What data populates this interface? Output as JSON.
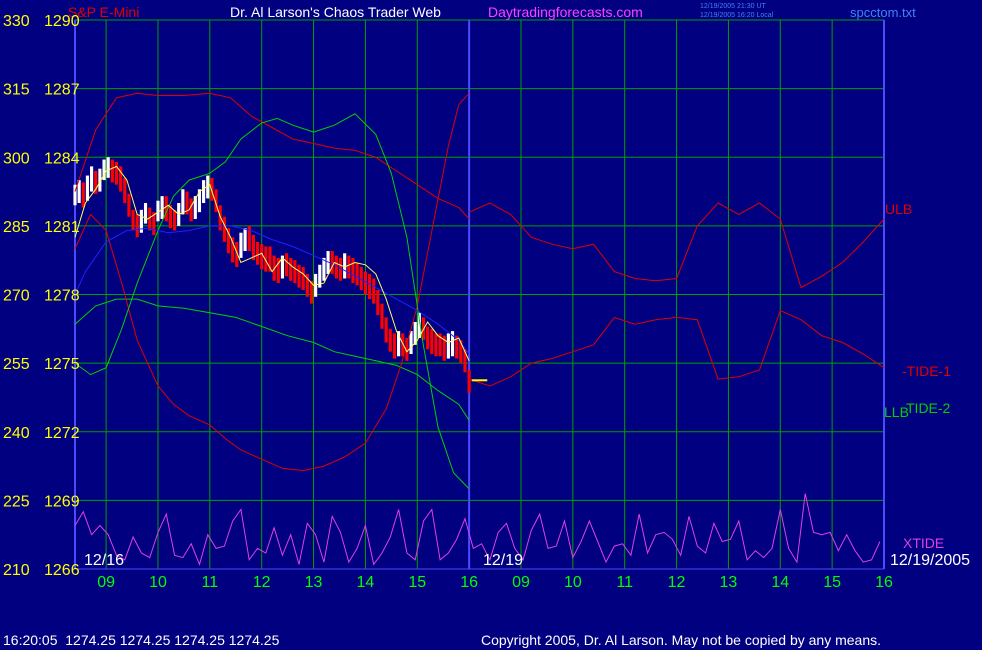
{
  "header": {
    "instrument": "S&P E-Mini",
    "title": "Dr. Al Larson's Chaos Trader Web",
    "site": "Daytradingforecasts.com",
    "timestamp_ut": "12/19/2005 21:30 UT",
    "timestamp_local": "12/19/2005 16:20 Local",
    "file": "spcctom.txt"
  },
  "footer": {
    "quote": "16:20:05  1274.25 1274.25 1274.25 1274.25",
    "copyright": "Copyright 2005, Dr. Al Larson. May not be copied by any means."
  },
  "colors": {
    "background": "#000080",
    "grid": "#00a000",
    "axis": "#4a4aff",
    "price_labels": "#ffff00",
    "time_labels": "#00ff00",
    "date_labels": "#ffffff",
    "ulb": "#e00000",
    "llb": "#00d000",
    "tide1": "#e00000",
    "tide2": "#00d000",
    "xtide": "#e040e0",
    "sma": "#2020ff",
    "price_line": "#ffff60",
    "up_bar": "#ffffff",
    "down_bar": "#ff0000",
    "header_title": "#ffffff",
    "header_site": "#ff40ff",
    "header_file": "#4080ff",
    "footer_text": "#ffffff"
  },
  "chart_data": {
    "type": "line",
    "left_axis_labels": [
      "330",
      "315",
      "300",
      "285",
      "270",
      "255",
      "240",
      "225",
      "210"
    ],
    "price_axis_labels": [
      "1290",
      "1287",
      "1284",
      "1281",
      "1278",
      "1275",
      "1272",
      "1269",
      "1266"
    ],
    "price_range": [
      1266,
      1290
    ],
    "time_labels": [
      "09",
      "10",
      "11",
      "12",
      "13",
      "14",
      "15",
      "16",
      "09",
      "10",
      "11",
      "12",
      "13",
      "14",
      "15",
      "16"
    ],
    "date_labels": [
      "12/16",
      "12/19",
      "12/19/2005"
    ],
    "series_labels": {
      "ulb": "ULB",
      "llb": "LLB",
      "tide1": "-TIDE-1",
      "tide2": "TIDE-2",
      "xtide": "XTIDE"
    },
    "last_price_marker": 1274.25,
    "series": [
      {
        "key": "ulb",
        "x": [
          8.4,
          8.8,
          9.2,
          9.6,
          10,
          10.5,
          11,
          11.4,
          11.8,
          12.2,
          12.6,
          13,
          13.4,
          13.8,
          14.2,
          14.6,
          15,
          15.4,
          15.8,
          16
        ],
        "y": [
          1282.5,
          1285.2,
          1286.6,
          1286.8,
          1286.7,
          1286.7,
          1286.8,
          1286.6,
          1285.8,
          1285.3,
          1284.8,
          1284.6,
          1284.4,
          1284.3,
          1284.0,
          1283.4,
          1282.8,
          1282.2,
          1281.8,
          1281.3
        ]
      },
      {
        "key": "llb",
        "x": [
          8.4,
          8.8,
          9.2,
          9.6,
          10,
          10.5,
          11,
          11.5,
          12,
          12.5,
          13,
          13.4,
          13.8,
          14.2,
          14.6,
          15,
          15.4,
          15.8,
          16
        ],
        "y": [
          1276.7,
          1277.5,
          1277.8,
          1277.8,
          1277.5,
          1277.4,
          1277.2,
          1277.0,
          1276.6,
          1276.2,
          1275.9,
          1275.5,
          1275.3,
          1275.1,
          1274.9,
          1274.5,
          1273.8,
          1273.2,
          1272.5
        ]
      },
      {
        "key": "tide1",
        "x": [
          8.4,
          8.7,
          9.0,
          9.3,
          9.6,
          10,
          10.3,
          10.6,
          11,
          11.3,
          11.6,
          12,
          12.4,
          12.8,
          13.2,
          13.6,
          14,
          14.4,
          14.7,
          15,
          15.3,
          15.6,
          15.8,
          16
        ],
        "y": [
          1280,
          1281.5,
          1280.8,
          1278.5,
          1276,
          1274,
          1273.2,
          1272.7,
          1272.3,
          1271.7,
          1271.2,
          1270.8,
          1270.4,
          1270.3,
          1270.5,
          1270.9,
          1271.5,
          1273,
          1275,
          1277.5,
          1281,
          1284.5,
          1286.3,
          1286.8
        ]
      },
      {
        "key": "tide2",
        "x": [
          8.4,
          8.7,
          9.0,
          9.3,
          9.6,
          10,
          10.3,
          10.6,
          11,
          11.3,
          11.6,
          12,
          12.3,
          12.6,
          13,
          13.4,
          13.8,
          14.2,
          14.5,
          14.8,
          15.1,
          15.4,
          15.7,
          16
        ],
        "y": [
          1275.0,
          1274.5,
          1274.8,
          1276.5,
          1278.5,
          1280.8,
          1282.3,
          1283,
          1283.3,
          1283.8,
          1284.8,
          1285.5,
          1285.7,
          1285.4,
          1285.1,
          1285.4,
          1285.9,
          1285.0,
          1283.3,
          1280.5,
          1276.0,
          1272.2,
          1270.2,
          1269.5
        ]
      },
      {
        "key": "sma",
        "x": [
          8.4,
          8.6,
          9.0,
          9.4,
          9.8,
          10.2,
          10.6,
          11,
          11.4,
          11.8,
          12.2,
          12.6,
          13,
          13.4,
          13.8,
          14.2,
          14.6,
          15,
          15.4,
          15.8,
          16
        ],
        "y": [
          1278.0,
          1279.0,
          1280.3,
          1280.8,
          1280.9,
          1280.7,
          1280.8,
          1281.0,
          1281.0,
          1280.8,
          1280.4,
          1280.1,
          1279.7,
          1279.3,
          1278.8,
          1278.3,
          1277.8,
          1277.3,
          1276.7,
          1276.0,
          1275.4
        ]
      },
      {
        "key": "price_line",
        "x": [
          8.4,
          8.6,
          8.8,
          9.0,
          9.2,
          9.4,
          9.6,
          9.8,
          10.0,
          10.2,
          10.4,
          10.6,
          10.8,
          11.0,
          11.2,
          11.4,
          11.6,
          11.8,
          12.0,
          12.2,
          12.4,
          12.6,
          12.8,
          13.0,
          13.2,
          13.4,
          13.6,
          13.8,
          14.0,
          14.2,
          14.4,
          14.6,
          14.8,
          15.0,
          15.2,
          15.4,
          15.6,
          15.8,
          16.0
        ],
        "y": [
          1280.5,
          1282.0,
          1282.6,
          1283.4,
          1283.6,
          1283.0,
          1281.5,
          1281.3,
          1281.6,
          1281.9,
          1281.5,
          1281.7,
          1282.5,
          1282.8,
          1281.4,
          1280.5,
          1279.4,
          1279.6,
          1279.8,
          1279.0,
          1279.6,
          1279.2,
          1278.9,
          1278.4,
          1278.5,
          1279.4,
          1279.2,
          1279.4,
          1279.3,
          1278.9,
          1277.8,
          1276.4,
          1275.5,
          1276.0,
          1276.8,
          1276.2,
          1275.9,
          1276.1,
          1275.1
        ]
      },
      {
        "key": "ulb",
        "x": [
          16.0,
          16.4,
          16.8,
          17.2,
          17.6,
          18.0,
          18.4,
          18.8,
          19.2,
          19.6,
          20.0,
          20.4,
          20.8,
          21.2,
          21.6,
          22.0,
          22.4,
          22.8,
          23.2,
          23.6,
          24.0
        ],
        "y": [
          1281.6,
          1282.0,
          1281.5,
          1280.5,
          1280.2,
          1280.0,
          1280.2,
          1279.0,
          1278.7,
          1278.6,
          1278.7,
          1281.0,
          1282.0,
          1281.5,
          1282.0,
          1281.3,
          1278.3,
          1278.8,
          1279.4,
          1280.3,
          1281.3
        ]
      },
      {
        "key": "tide1",
        "x": [
          16.0,
          16.4,
          16.8,
          17.2,
          17.6,
          18.0,
          18.4,
          18.8,
          19.2,
          19.6,
          20.0,
          20.4,
          20.8,
          21.2,
          21.6,
          22.0,
          22.4,
          22.8,
          23.2,
          23.6,
          24.0
        ],
        "y": [
          1274.3,
          1274.0,
          1274.4,
          1275.0,
          1275.2,
          1275.5,
          1275.8,
          1277.0,
          1276.7,
          1276.9,
          1277.0,
          1276.9,
          1274.3,
          1274.4,
          1274.7,
          1277.3,
          1276.9,
          1276.2,
          1275.9,
          1275.4,
          1274.8
        ]
      }
    ],
    "bars": {
      "x": [
        8.4,
        8.48,
        8.56,
        8.64,
        8.72,
        8.8,
        8.88,
        8.96,
        9.04,
        9.12,
        9.2,
        9.28,
        9.36,
        9.44,
        9.52,
        9.6,
        9.68,
        9.76,
        9.84,
        9.92,
        10.0,
        10.08,
        10.16,
        10.24,
        10.32,
        10.4,
        10.48,
        10.56,
        10.64,
        10.72,
        10.8,
        10.88,
        10.96,
        11.04,
        11.12,
        11.2,
        11.28,
        11.36,
        11.44,
        11.52,
        11.6,
        11.68,
        11.76,
        11.84,
        11.92,
        12.0,
        12.08,
        12.16,
        12.24,
        12.32,
        12.4,
        12.48,
        12.56,
        12.64,
        12.72,
        12.8,
        12.88,
        12.96,
        13.04,
        13.12,
        13.2,
        13.28,
        13.36,
        13.44,
        13.52,
        13.6,
        13.68,
        13.76,
        13.84,
        13.92,
        14.0,
        14.08,
        14.16,
        14.24,
        14.32,
        14.4,
        14.48,
        14.56,
        14.64,
        14.72,
        14.8,
        14.88,
        14.96,
        15.04,
        15.12,
        15.2,
        15.28,
        15.36,
        15.44,
        15.52,
        15.6,
        15.68,
        15.76,
        15.84,
        15.92,
        16.0
      ],
      "high": [
        1282.8,
        1283.0,
        1282.9,
        1283.2,
        1283.6,
        1283.4,
        1283.5,
        1283.9,
        1284.0,
        1283.9,
        1283.8,
        1283.6,
        1283.1,
        1282.4,
        1281.7,
        1281.5,
        1281.7,
        1282.0,
        1281.8,
        1281.6,
        1282.1,
        1282.3,
        1282.3,
        1281.9,
        1281.7,
        1282.0,
        1282.6,
        1282.5,
        1282.2,
        1282.3,
        1282.6,
        1283.0,
        1283.2,
        1283.1,
        1282.6,
        1281.9,
        1281.4,
        1280.9,
        1280.5,
        1280.3,
        1280.7,
        1280.9,
        1281.0,
        1280.6,
        1280.3,
        1280.2,
        1280.1,
        1280.1,
        1279.7,
        1279.6,
        1279.7,
        1279.8,
        1279.6,
        1279.5,
        1279.3,
        1279.2,
        1278.9,
        1278.6,
        1278.9,
        1279.3,
        1279.6,
        1279.9,
        1279.9,
        1279.7,
        1279.6,
        1279.8,
        1279.7,
        1279.6,
        1279.4,
        1279.2,
        1279.0,
        1278.9,
        1278.7,
        1278.2,
        1277.6,
        1277.0,
        1276.5,
        1276.3,
        1276.4,
        1276.3,
        1276.1,
        1276.4,
        1276.8,
        1277.2,
        1277.0,
        1276.6,
        1276.5,
        1276.3,
        1276.3,
        1276.2,
        1276.3,
        1276.4,
        1276.2,
        1276.0,
        1275.6,
        1274.7
      ],
      "low": [
        1281.9,
        1282.0,
        1281.8,
        1282.1,
        1282.5,
        1282.4,
        1282.5,
        1283.0,
        1283.1,
        1282.9,
        1282.8,
        1282.5,
        1282.0,
        1281.4,
        1280.8,
        1280.5,
        1280.7,
        1281.1,
        1280.8,
        1280.6,
        1281.2,
        1281.3,
        1281.2,
        1280.9,
        1280.8,
        1281.0,
        1281.5,
        1281.5,
        1281.2,
        1281.3,
        1281.6,
        1282.0,
        1282.2,
        1282.1,
        1281.6,
        1280.8,
        1280.3,
        1279.8,
        1279.4,
        1279.2,
        1279.6,
        1279.9,
        1279.9,
        1279.5,
        1279.3,
        1279.1,
        1279.0,
        1279.0,
        1278.6,
        1278.5,
        1278.7,
        1278.8,
        1278.6,
        1278.5,
        1278.3,
        1278.2,
        1277.9,
        1277.6,
        1277.9,
        1278.3,
        1278.6,
        1278.9,
        1278.9,
        1278.7,
        1278.6,
        1278.7,
        1278.7,
        1278.5,
        1278.4,
        1278.2,
        1278.0,
        1277.8,
        1277.6,
        1277.1,
        1276.5,
        1275.9,
        1275.5,
        1275.2,
        1275.3,
        1275.3,
        1275.1,
        1275.4,
        1275.8,
        1276.1,
        1276.0,
        1275.6,
        1275.4,
        1275.3,
        1275.3,
        1275.1,
        1275.2,
        1275.3,
        1275.2,
        1275.0,
        1274.6,
        1273.7
      ],
      "up": [
        true,
        true,
        false,
        true,
        true,
        false,
        true,
        true,
        true,
        false,
        false,
        false,
        false,
        false,
        false,
        false,
        true,
        true,
        false,
        false,
        true,
        true,
        false,
        false,
        false,
        true,
        true,
        false,
        false,
        true,
        true,
        true,
        true,
        false,
        false,
        false,
        false,
        false,
        false,
        false,
        true,
        true,
        false,
        false,
        false,
        false,
        false,
        false,
        false,
        false,
        true,
        false,
        false,
        false,
        false,
        false,
        false,
        false,
        true,
        true,
        true,
        true,
        false,
        false,
        false,
        true,
        false,
        false,
        false,
        false,
        false,
        false,
        false,
        false,
        false,
        false,
        false,
        false,
        true,
        false,
        false,
        true,
        true,
        true,
        false,
        false,
        false,
        false,
        false,
        false,
        true,
        true,
        false,
        false,
        false,
        false
      ]
    },
    "xtide": {
      "x": [
        8.4,
        8.56,
        8.72,
        8.88,
        9.04,
        9.2,
        9.36,
        9.52,
        9.68,
        9.84,
        10.0,
        10.16,
        10.32,
        10.48,
        10.64,
        10.8,
        10.96,
        11.12,
        11.28,
        11.44,
        11.6,
        11.76,
        11.92,
        12.08,
        12.24,
        12.4,
        12.56,
        12.72,
        12.88,
        13.04,
        13.2,
        13.36,
        13.52,
        13.68,
        13.84,
        14.0,
        14.16,
        14.32,
        14.48,
        14.64,
        14.8,
        14.96,
        15.12,
        15.28,
        15.44,
        15.6,
        15.76,
        15.92,
        16.08,
        16.24,
        16.4,
        16.56,
        16.72,
        16.88,
        17.04,
        17.2,
        17.36,
        17.52,
        17.68,
        17.84,
        18.0,
        18.16,
        18.32,
        18.48,
        18.64,
        18.8,
        18.96,
        19.12,
        19.28,
        19.44,
        19.6,
        19.76,
        19.92,
        20.08,
        20.24,
        20.4,
        20.56,
        20.72,
        20.88,
        21.04,
        21.2,
        21.36,
        21.52,
        21.68,
        21.84,
        22.0,
        22.16,
        22.32,
        22.48,
        22.64,
        22.8,
        22.96,
        23.12,
        23.28,
        23.44,
        23.6,
        23.76,
        23.92
      ],
      "y": [
        1267.9,
        1268.5,
        1267.5,
        1267.9,
        1267.5,
        1266.6,
        1266.4,
        1267.4,
        1266.7,
        1266.5,
        1267.6,
        1268.4,
        1266.6,
        1266.5,
        1267.1,
        1266.2,
        1267.5,
        1266.9,
        1267.0,
        1268.1,
        1268.6,
        1266.4,
        1266.9,
        1266.7,
        1267.8,
        1266.6,
        1267.5,
        1266.2,
        1268.0,
        1267.5,
        1266.3,
        1268.3,
        1267.6,
        1266.3,
        1266.9,
        1267.9,
        1266.2,
        1266.7,
        1267.4,
        1268.6,
        1266.7,
        1266.4,
        1268.1,
        1268.6,
        1266.4,
        1266.7,
        1267.3,
        1268.2,
        1266.9,
        1267.1,
        1266.4,
        1267.6,
        1268.0,
        1266.9,
        1266.4,
        1267.7,
        1268.4,
        1266.9,
        1267.0,
        1268.1,
        1266.5,
        1267.2,
        1268.1,
        1267.2,
        1266.3,
        1267.0,
        1267.1,
        1266.6,
        1268.4,
        1266.7,
        1267.5,
        1267.6,
        1267.3,
        1266.6,
        1268.3,
        1267.0,
        1266.7,
        1268.0,
        1267.2,
        1267.3,
        1268.1,
        1266.4,
        1266.8,
        1266.5,
        1266.9,
        1268.6,
        1266.9,
        1266.3,
        1269.3,
        1267.6,
        1267.5,
        1267.6,
        1266.8,
        1267.5,
        1266.8,
        1266.3,
        1266.4,
        1267.2
      ]
    }
  }
}
